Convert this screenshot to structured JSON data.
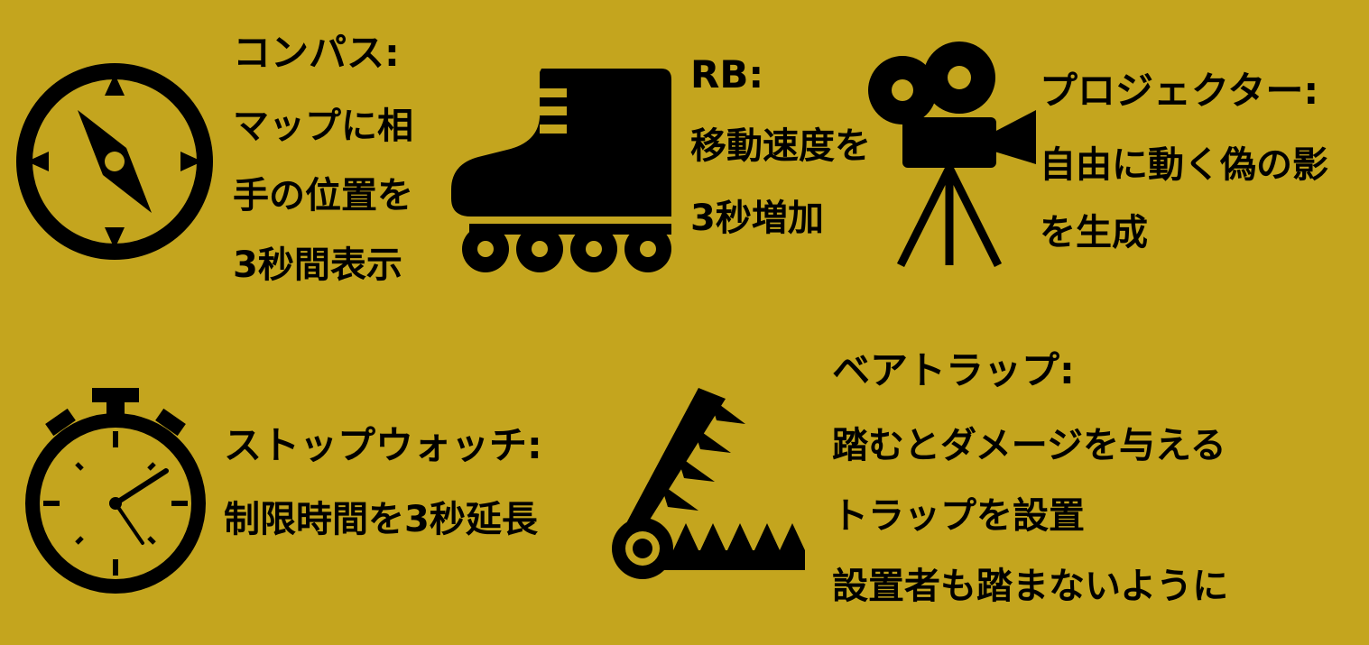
{
  "items": {
    "compass": {
      "icon": "compass-icon",
      "title": "コンパス:",
      "lines": [
        "マップに相",
        "手の位置を",
        "3秒間表示"
      ]
    },
    "rollerblade": {
      "icon": "inline-skate-icon",
      "title": "RB:",
      "lines": [
        "移動速度を",
        "3秒増加"
      ]
    },
    "projector": {
      "icon": "movie-projector-icon",
      "title": "プロジェクター:",
      "lines": [
        "自由に動く偽の影",
        "を生成"
      ]
    },
    "stopwatch": {
      "icon": "stopwatch-icon",
      "title": "ストップウォッチ:",
      "lines": [
        "制限時間を3秒延長"
      ]
    },
    "beartrap": {
      "icon": "bear-trap-icon",
      "title": "ベアトラップ:",
      "lines": [
        "踏むとダメージを与える",
        "トラップを設置",
        "設置者も踏まないように"
      ]
    }
  },
  "colors": {
    "background": "#c4a51e",
    "foreground": "#000000"
  }
}
